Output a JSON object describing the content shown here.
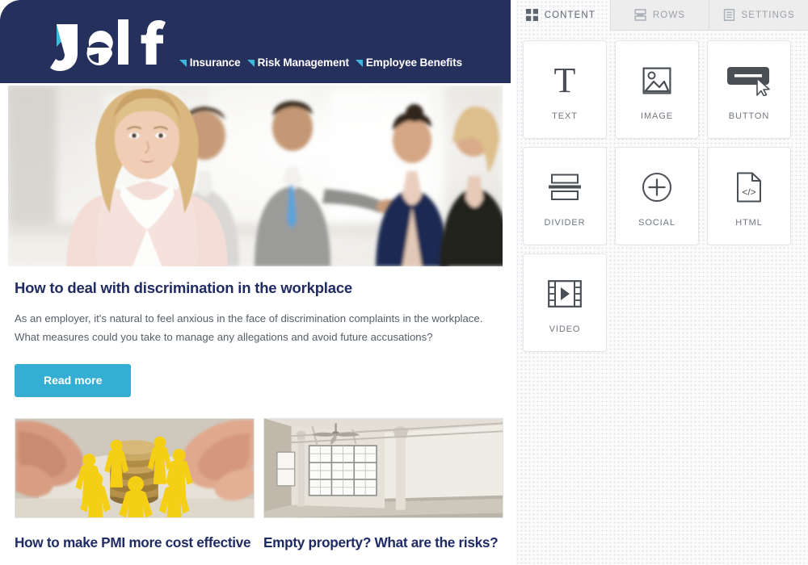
{
  "email": {
    "brand": {
      "logo_text": "Jelf",
      "logo_accent_color": "#3fb8dd",
      "header_bg": "#26305c"
    },
    "nav": [
      {
        "label": "Insurance",
        "icon": "triangle-bullet-icon"
      },
      {
        "label": "Risk Management",
        "icon": "triangle-bullet-icon"
      },
      {
        "label": "Employee Benefits",
        "icon": "triangle-bullet-icon"
      }
    ],
    "hero": {
      "alt": "Businesswoman in pale pink blazer standing in a bright office with blurred colleagues behind her"
    },
    "article": {
      "headline": "How to deal with discrimination in the workplace",
      "body": "As an employer, it's natural to feel anxious in the face of discrimination complaints in the workplace. What measures could you take to manage any allegations and avoid future accusations?",
      "cta_label": "Read more",
      "cta_color": "#35aed3",
      "headline_color": "#1f2b63"
    },
    "teasers": [
      {
        "headline": "How to make PMI more cost effective",
        "image_alt": "Hands cupping yellow figurines standing around a stack of coins"
      },
      {
        "headline": "Empty property? What are the risks?",
        "image_alt": "Empty industrial loft interior with large windows, columns and a ceiling fan"
      }
    ]
  },
  "sidebar": {
    "tabs": [
      {
        "label": "CONTENT",
        "icon": "grid-icon",
        "active": true
      },
      {
        "label": "ROWS",
        "icon": "rows-icon",
        "active": false
      },
      {
        "label": "SETTINGS",
        "icon": "settings-document-icon",
        "active": false
      }
    ],
    "tiles": [
      {
        "label": "TEXT",
        "icon": "text-t-icon"
      },
      {
        "label": "IMAGE",
        "icon": "image-icon"
      },
      {
        "label": "BUTTON",
        "icon": "button-cursor-icon"
      },
      {
        "label": "DIVIDER",
        "icon": "divider-icon"
      },
      {
        "label": "SOCIAL",
        "icon": "plus-circle-icon"
      },
      {
        "label": "HTML",
        "icon": "code-file-icon"
      },
      {
        "label": "VIDEO",
        "icon": "video-film-icon"
      }
    ]
  }
}
